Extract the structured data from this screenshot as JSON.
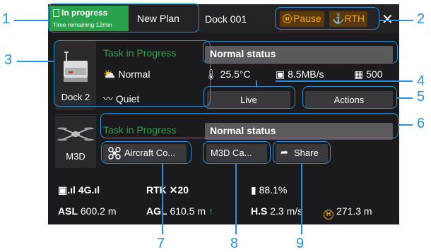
{
  "topbar": {
    "status_title": "In progress",
    "status_sub": "Time remaining 12min",
    "plan_name": "New Plan",
    "dock_name": "Dock 001",
    "pause_label": "Pause",
    "rth_label": "RTH",
    "close_label": "✕"
  },
  "dock": {
    "name": "Dock 2",
    "task_status": "Task in Progress",
    "status_text": "Normal status",
    "weather": "Normal",
    "noise": "Quiet",
    "temperature": "25.5°C",
    "network": "8.5MB/s",
    "count": "500",
    "live_label": "Live",
    "actions_label": "Actions"
  },
  "aircraft": {
    "name": "M3D",
    "task_status": "Task in Progress",
    "status_text": "Normal status",
    "aircraft_control_label": "Aircraft Co...",
    "camera_label": "M3D Ca...",
    "share_label": "Share"
  },
  "telemetry": {
    "signal": "4G",
    "rtk_label": "RTK",
    "rtk_count": "20",
    "battery": "88.1%",
    "asl_label": "ASL",
    "asl_value": "600.2 m",
    "agl_label": "AGL",
    "agl_value": "610.5 m",
    "hs_label": "H.S",
    "hs_value": "2.3 m/s",
    "distance_value": "271.3 m"
  },
  "callouts": [
    "1",
    "2",
    "3",
    "4",
    "5",
    "6",
    "7",
    "8",
    "9"
  ],
  "colors": {
    "accent_green": "#2aa14b",
    "accent_orange": "#f2a419",
    "callout_blue": "#2a8fd6",
    "panel_bg": "#1b1b1d"
  }
}
